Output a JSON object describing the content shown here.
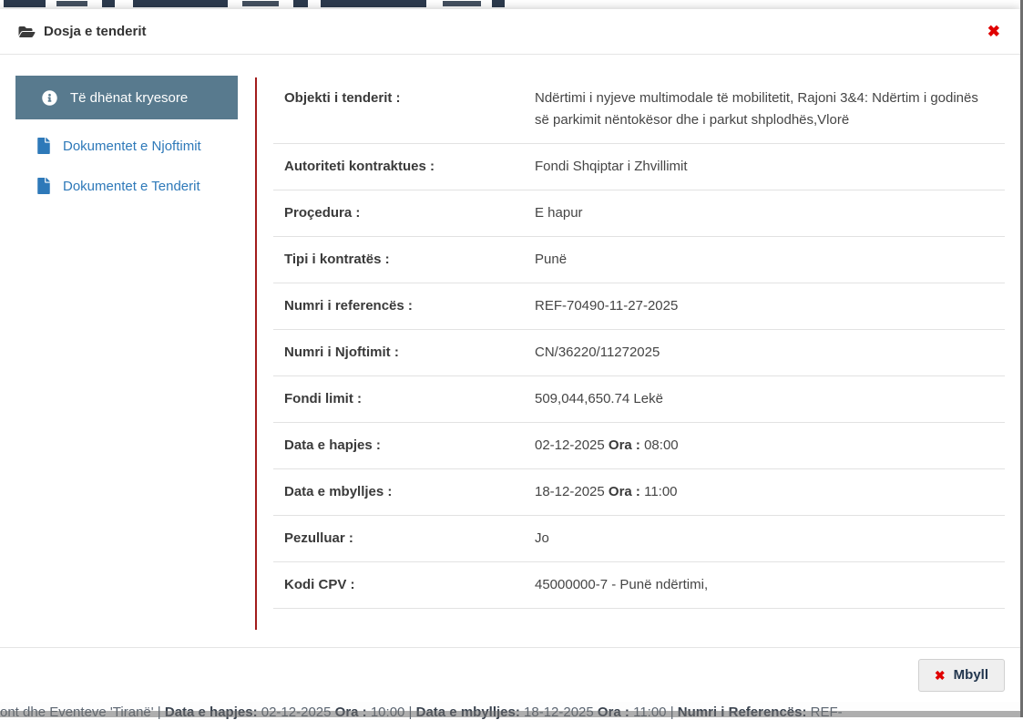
{
  "modal": {
    "title": "Dosja e tenderit",
    "title_icon": "folder-open-icon",
    "close_icon": "close-x-icon",
    "sidebar": {
      "items": [
        {
          "label": "Të dhënat kryesore",
          "icon": "info-circle",
          "active": true
        },
        {
          "label": "Dokumentet e Njoftimit",
          "icon": "file",
          "active": false
        },
        {
          "label": "Dokumentet e Tenderit",
          "icon": "file",
          "active": false
        }
      ]
    },
    "details": {
      "rows": [
        {
          "label": "Objekti i tenderit :",
          "value": "Ndërtimi i nyjeve multimodale të mobilitetit, Rajoni 3&4: Ndërtim i godinës së parkimit nëntokësor dhe i parkut shplodhës,Vlorë"
        },
        {
          "label": "Autoriteti kontraktues :",
          "value": "Fondi Shqiptar i Zhvillimit"
        },
        {
          "label": "Proçedura :",
          "value": "E hapur"
        },
        {
          "label": "Tipi i kontratës :",
          "value": "Punë"
        },
        {
          "label": "Numri i referencës :",
          "value": "REF-70490-11-27-2025"
        },
        {
          "label": "Numri i Njoftimit :",
          "value": "CN/36220/11272025"
        },
        {
          "label": "Fondi limit :",
          "value": "509,044,650.74 Lekë"
        },
        {
          "label": "Data e hapjes :",
          "value": "02-12-2025",
          "time_label": "Ora :",
          "time": "08:00"
        },
        {
          "label": "Data e mbylljes :",
          "value": "18-12-2025",
          "time_label": "Ora :",
          "time": "11:00"
        },
        {
          "label": "Pezulluar :",
          "value": "Jo"
        },
        {
          "label": "Kodi CPV :",
          "value": "45000000-7 - Punë ndërtimi,"
        }
      ]
    },
    "footer": {
      "close_button_label": "Mbyll",
      "close_button_icon": "close-x-icon"
    }
  },
  "background_page": {
    "bottom_fragment_segments": [
      {
        "text": "ont dhe Eventeve 'Tiranë'",
        "bold": false
      },
      {
        "text": "   |   ",
        "bold": false
      },
      {
        "text": "Data e hapjes:",
        "bold": true
      },
      {
        "text": " 02-12-2025 ",
        "bold": false
      },
      {
        "text": "Ora :",
        "bold": true
      },
      {
        "text": " 10:00",
        "bold": false
      },
      {
        "text": "   |   ",
        "bold": false
      },
      {
        "text": "Data e mbylljes:",
        "bold": true
      },
      {
        "text": " 18-12-2025 ",
        "bold": false
      },
      {
        "text": "Ora :",
        "bold": true
      },
      {
        "text": " 11:00",
        "bold": false
      },
      {
        "text": "   |   ",
        "bold": false
      },
      {
        "text": "Numri i Referencës:",
        "bold": true
      },
      {
        "text": " REF-",
        "bold": false
      }
    ]
  },
  "colors": {
    "sidebar_active_bg": "#587a8e",
    "link_blue": "#2e79b9",
    "divider_red": "#a21c1c",
    "close_red": "#e00000",
    "button_text_navy": "#22364e",
    "row_border": "#e2e2e2"
  }
}
